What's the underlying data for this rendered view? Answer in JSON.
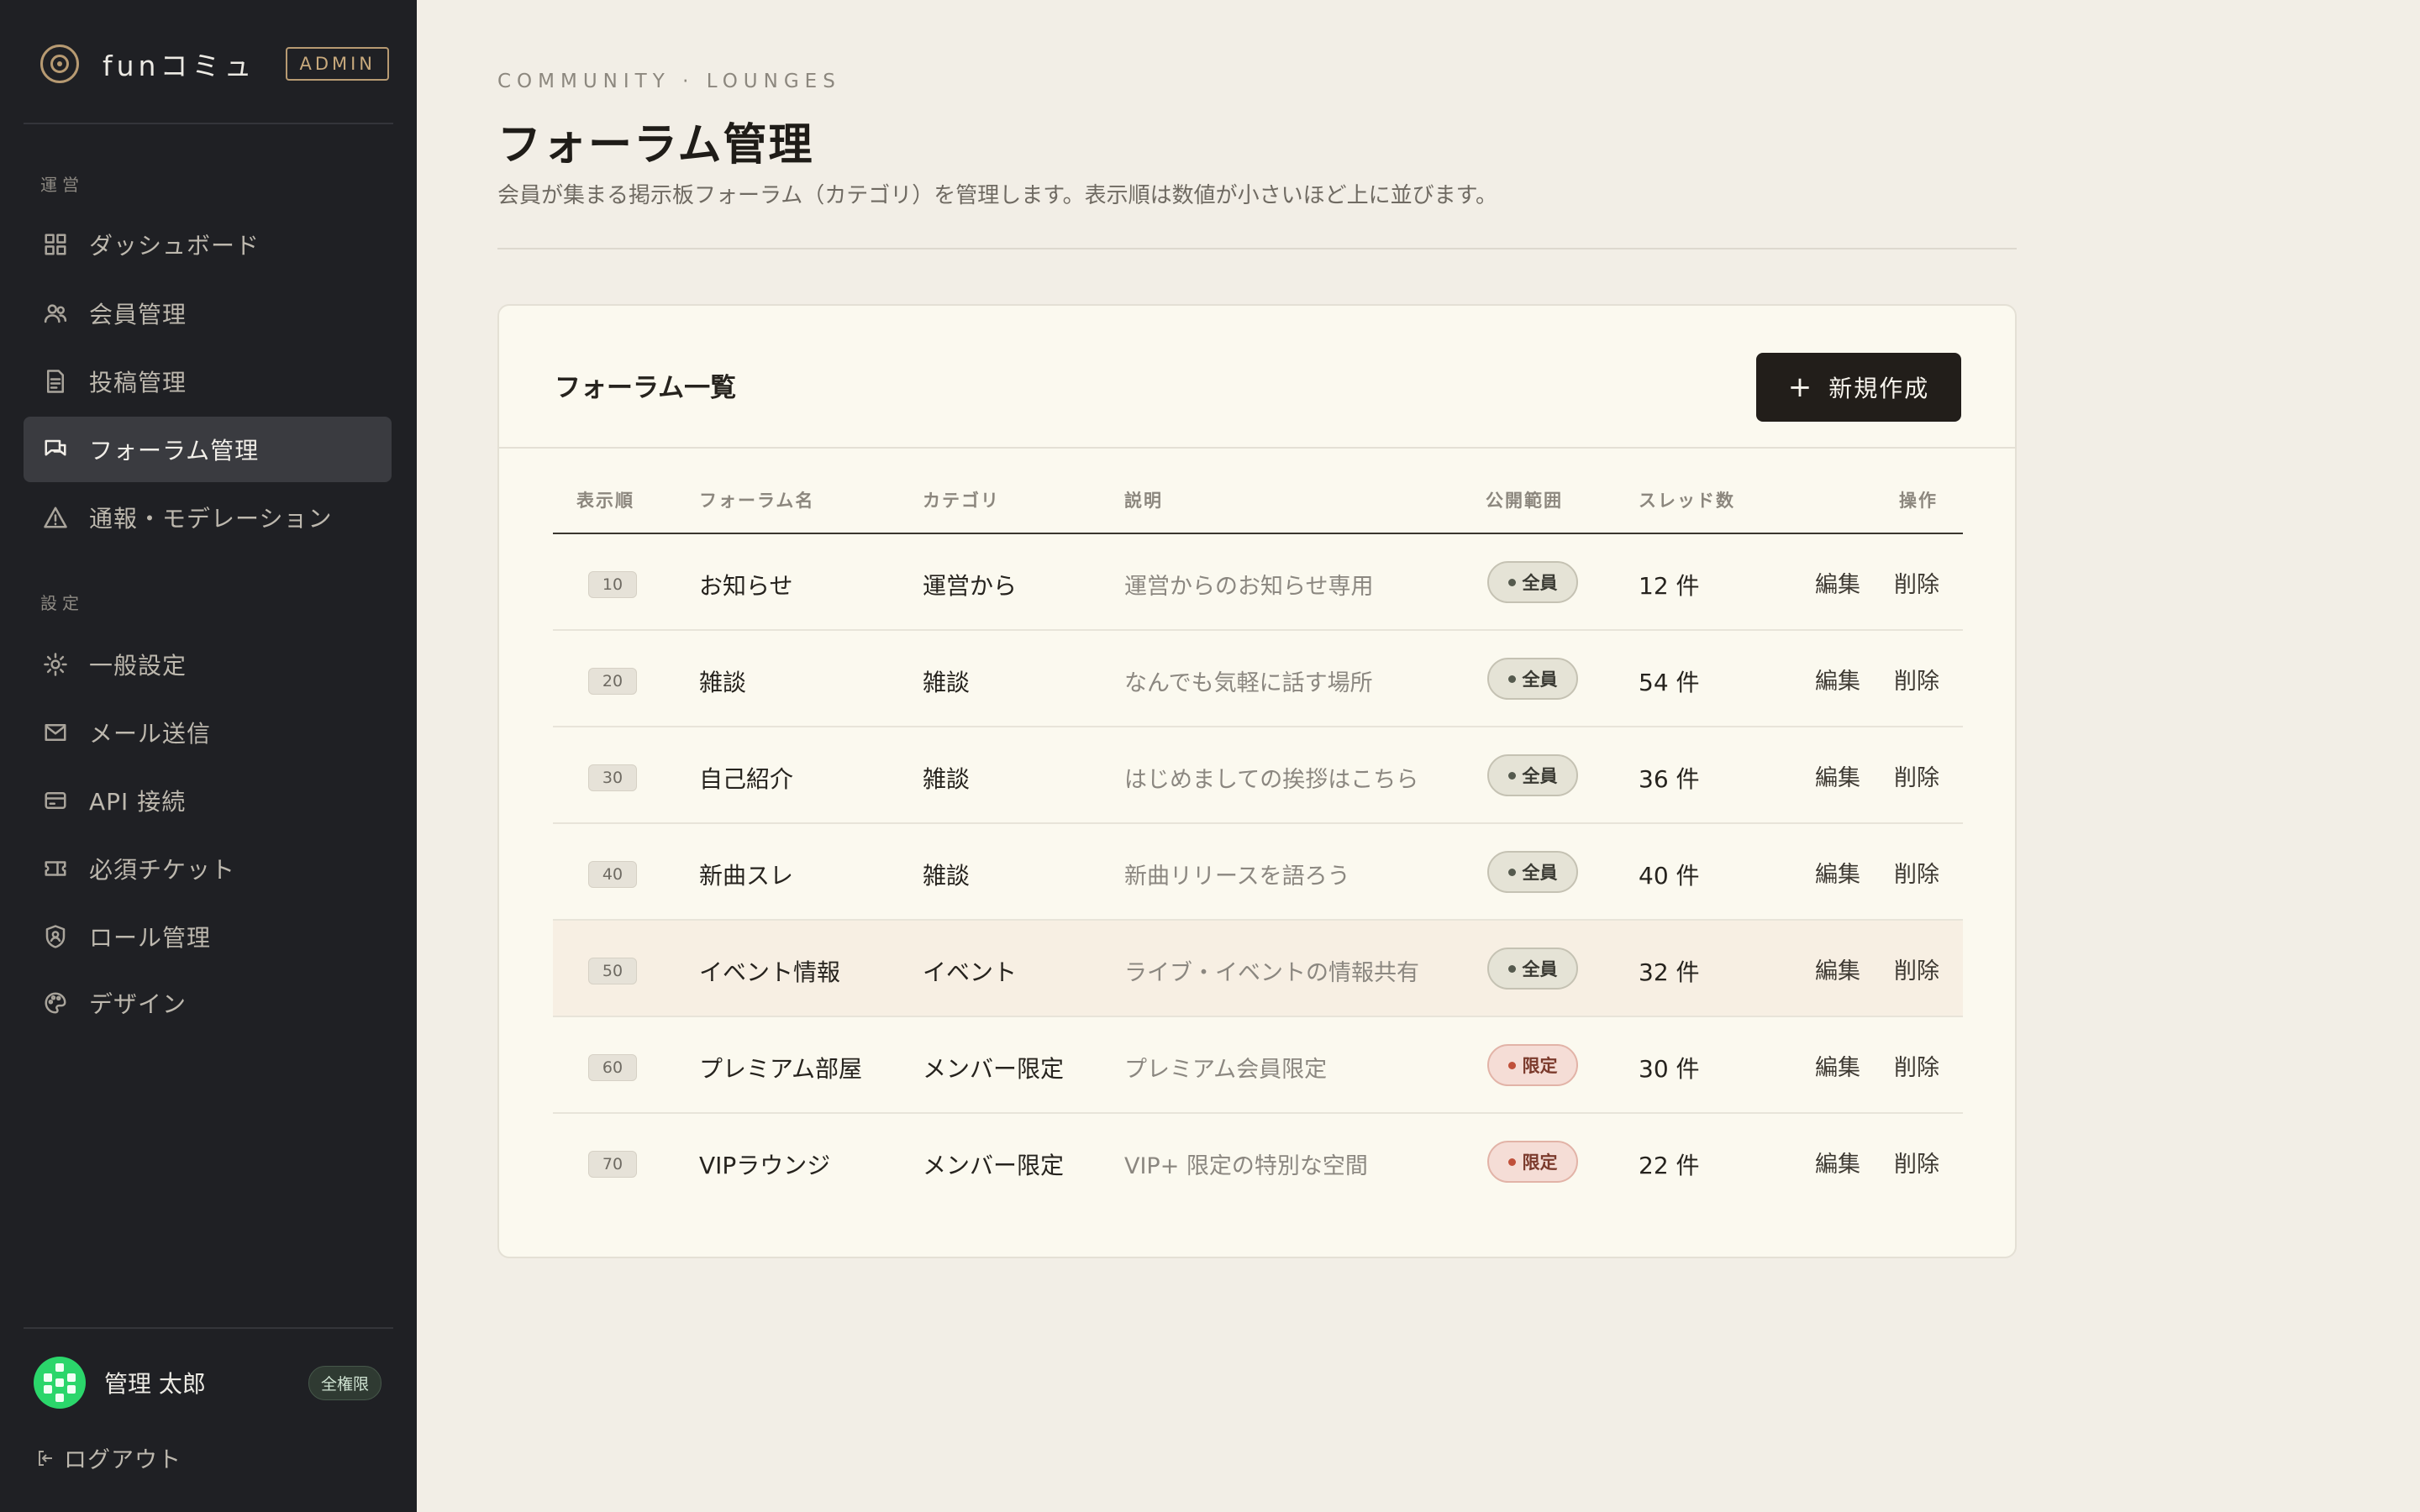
{
  "brand": {
    "name": "funコミュ",
    "badge": "ADMIN"
  },
  "sidebar": {
    "sections": [
      {
        "label": "運営"
      },
      {
        "label": "設定"
      }
    ],
    "items": [
      {
        "label": "ダッシュボード",
        "icon": "dashboard-icon"
      },
      {
        "label": "会員管理",
        "icon": "users-icon"
      },
      {
        "label": "投稿管理",
        "icon": "document-icon"
      },
      {
        "label": "フォーラム管理",
        "icon": "chat-icon",
        "active": true
      },
      {
        "label": "通報・モデレーション",
        "icon": "warning-icon"
      },
      {
        "label": "一般設定",
        "icon": "gear-icon"
      },
      {
        "label": "メール送信",
        "icon": "mail-icon"
      },
      {
        "label": "API 接続",
        "icon": "api-card-icon"
      },
      {
        "label": "必須チケット",
        "icon": "ticket-icon"
      },
      {
        "label": "ロール管理",
        "icon": "shield-icon"
      },
      {
        "label": "デザイン",
        "icon": "palette-icon"
      }
    ],
    "user": {
      "name": "管理 太郎",
      "badge": "全権限"
    },
    "logout": "ログアウト"
  },
  "header": {
    "eyebrow": "COMMUNITY · LOUNGES",
    "title": "フォーラム管理",
    "description": "会員が集まる掲示板フォーラム（カテゴリ）を管理します。表示順は数値が小さいほど上に並びます。"
  },
  "card": {
    "title": "フォーラム一覧",
    "new_button": "新規作成",
    "columns": [
      "表示順",
      "フォーラム名",
      "カテゴリ",
      "説明",
      "公開範囲",
      "スレッド数",
      "操作"
    ],
    "rows": [
      {
        "order": "10",
        "name": "お知らせ",
        "category": "運営から",
        "description": "運営からのお知らせ専用",
        "visibility": "全員",
        "threads": "12 件"
      },
      {
        "order": "20",
        "name": "雑談",
        "category": "雑談",
        "description": "なんでも気軽に話す場所",
        "visibility": "全員",
        "threads": "54 件"
      },
      {
        "order": "30",
        "name": "自己紹介",
        "category": "雑談",
        "description": "はじめましての挨拶はこちら",
        "visibility": "全員",
        "threads": "36 件"
      },
      {
        "order": "40",
        "name": "新曲スレ",
        "category": "雑談",
        "description": "新曲リリースを語ろう",
        "visibility": "全員",
        "threads": "40 件"
      },
      {
        "order": "50",
        "name": "イベント情報",
        "category": "イベント",
        "description": "ライブ・イベントの情報共有",
        "visibility": "全員",
        "threads": "32 件"
      },
      {
        "order": "60",
        "name": "プレミアム部屋",
        "category": "メンバー限定",
        "description": "プレミアム会員限定",
        "visibility": "限定",
        "threads": "30 件"
      },
      {
        "order": "70",
        "name": "VIPラウンジ",
        "category": "メンバー限定",
        "description": "VIP+ 限定の特別な空間",
        "visibility": "限定",
        "threads": "22 件"
      }
    ],
    "actions": {
      "edit": "編集",
      "delete": "削除"
    }
  },
  "colors": {
    "sidebar_bg": "#1f2024",
    "page_bg": "#f2eee6",
    "card_bg": "#fbf9ef",
    "accent": "#b79a72",
    "primary_button": "#221e1a",
    "badge_all": "#e5e3d6",
    "badge_limited": "#f5ddd6"
  }
}
